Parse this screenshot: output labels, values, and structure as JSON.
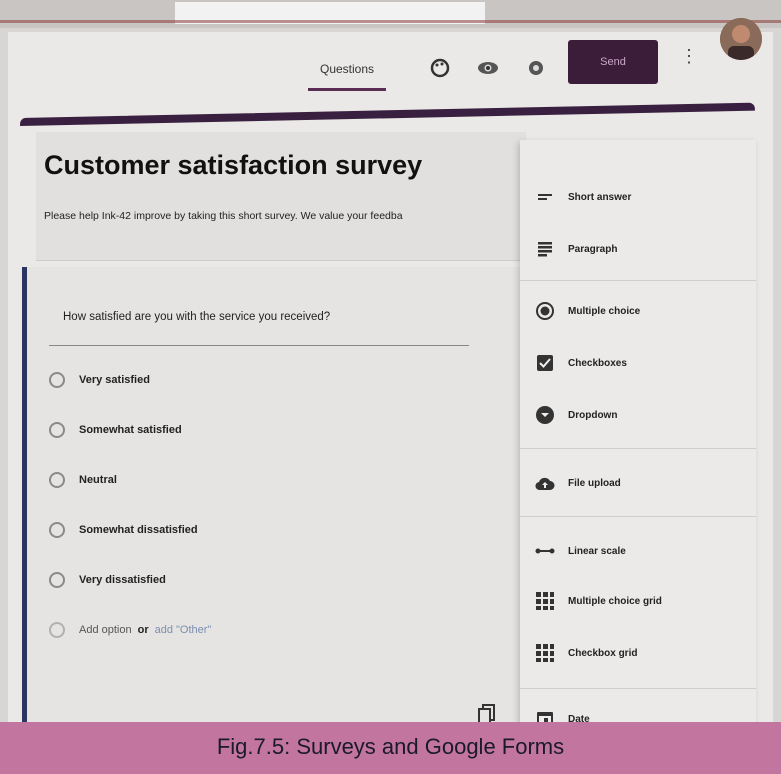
{
  "toolbar": {
    "tab_questions": "Questions",
    "send_label": "Send",
    "icons": [
      "palette-icon",
      "preview-eye-icon",
      "settings-gear-icon"
    ],
    "more_icon": "vertical-dots-icon"
  },
  "form": {
    "title": "Customer satisfaction survey",
    "description": "Please help Ink-42 improve by taking this short survey. We value your feedba"
  },
  "question": {
    "text": "How satisfied are you with the service you received?",
    "options": [
      "Very satisfied",
      "Somewhat satisfied",
      "Neutral",
      "Somewhat dissatisfied",
      "Very dissatisfied"
    ],
    "add_option": "Add option",
    "or": "or",
    "add_other": "add \"Other\""
  },
  "type_menu": {
    "items": [
      {
        "label": "Short answer",
        "icon": "short-answer-icon"
      },
      {
        "label": "Paragraph",
        "icon": "paragraph-icon"
      },
      {
        "label": "Multiple choice",
        "icon": "radio-icon"
      },
      {
        "label": "Checkboxes",
        "icon": "checkbox-icon"
      },
      {
        "label": "Dropdown",
        "icon": "dropdown-icon"
      },
      {
        "label": "File upload",
        "icon": "cloud-upload-icon"
      },
      {
        "label": "Linear scale",
        "icon": "linear-scale-icon"
      },
      {
        "label": "Multiple choice grid",
        "icon": "grid-icon"
      },
      {
        "label": "Checkbox grid",
        "icon": "checkbox-grid-icon"
      },
      {
        "label": "Date",
        "icon": "calendar-icon"
      }
    ]
  },
  "caption": "Fig.7.5: Surveys and Google Forms",
  "colors": {
    "accent": "#3a2040",
    "send_bg": "#3b1d3a",
    "caption_band": "#c2759f"
  }
}
